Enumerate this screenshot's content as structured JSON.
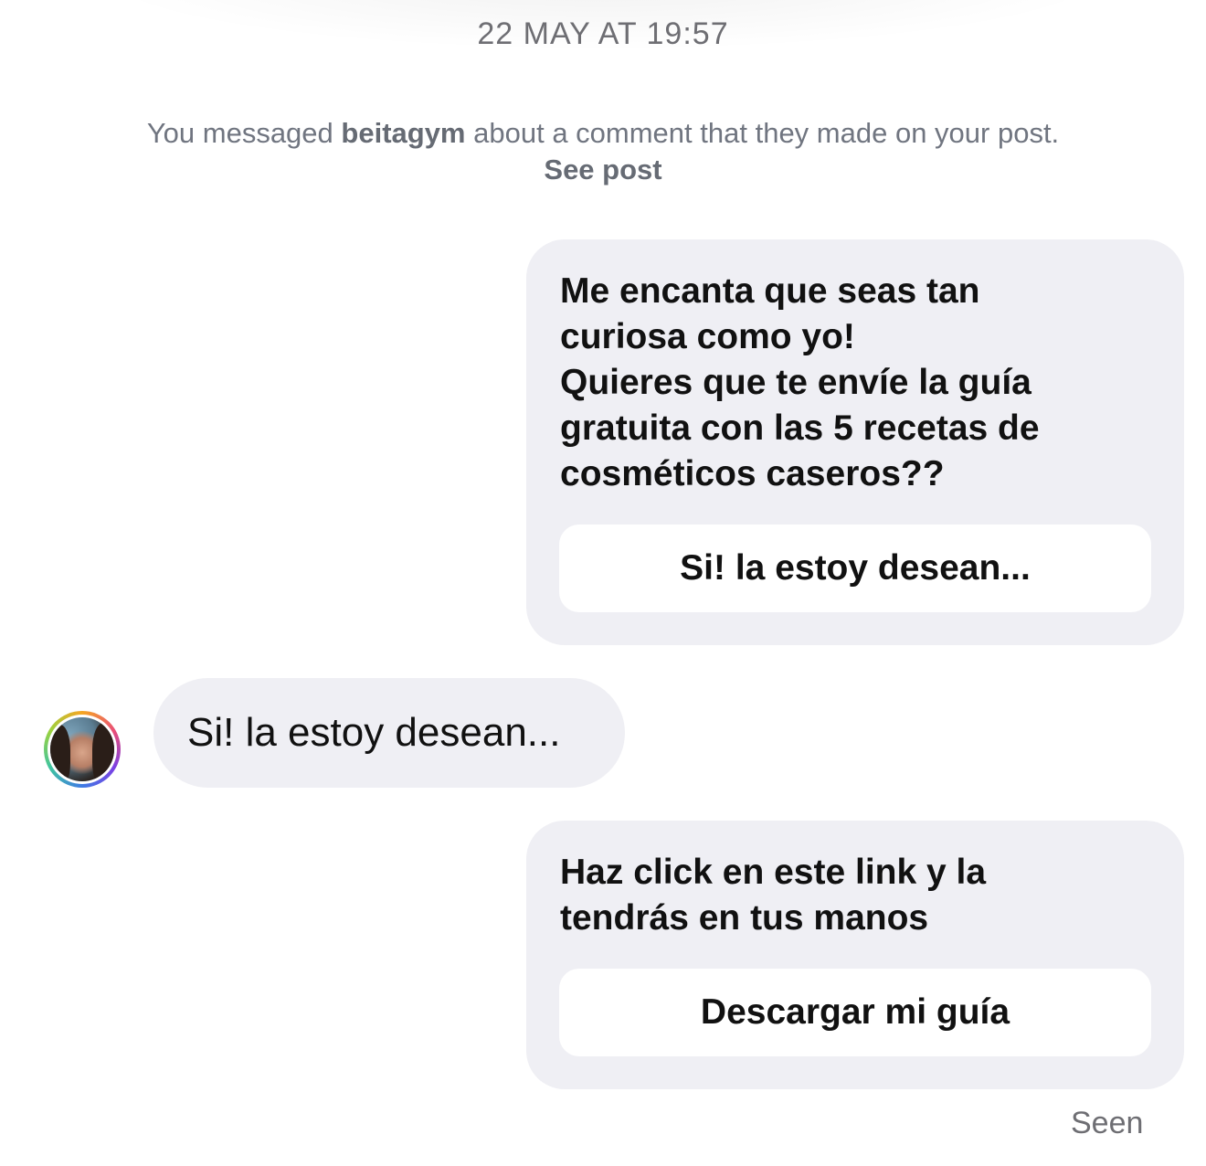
{
  "thread": {
    "timestamp": "22 MAY AT 19:57",
    "context_note": {
      "prefix": "You messaged ",
      "username": "beitagym",
      "middle": " about a comment that they made on your post. ",
      "link_label": "See post"
    },
    "messages": [
      {
        "direction": "outgoing",
        "text": "Me encanta que seas tan\ncuriosa como yo!\nQuieres que te envíe la guía\ngratuita con las 5 recetas de\ncosméticos caseros??",
        "button_label": "Si! la estoy desean..."
      },
      {
        "direction": "incoming",
        "avatar_icon": "profile-photo-avatar",
        "text": "Si! la estoy desean..."
      },
      {
        "direction": "outgoing",
        "text": "Haz click en este link y la\ntendrás en tus manos",
        "button_label": "Descargar mi guía"
      }
    ],
    "status": "Seen"
  },
  "colors": {
    "bubble_background": "#efeff4",
    "quick_reply_background": "#ffffff",
    "meta_text": "#6e6e73",
    "message_text": "#111111"
  }
}
